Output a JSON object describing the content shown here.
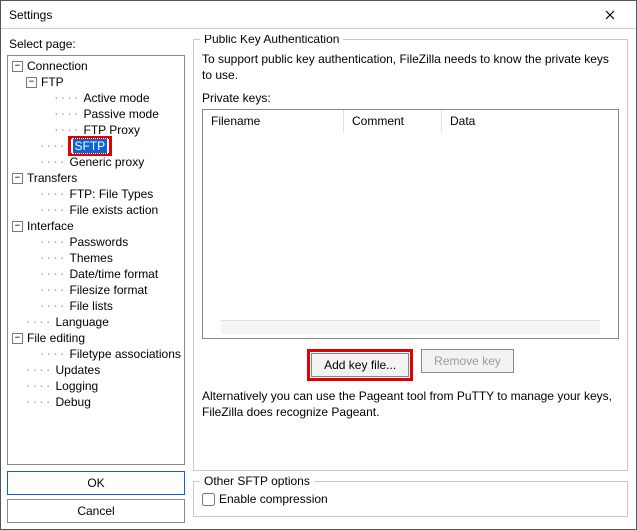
{
  "window": {
    "title": "Settings"
  },
  "left": {
    "label": "Select page:",
    "ok": "OK",
    "cancel": "Cancel"
  },
  "tree": {
    "connection": {
      "label": "Connection",
      "ftp": {
        "label": "FTP",
        "active": "Active mode",
        "passive": "Passive mode",
        "proxy": "FTP Proxy"
      },
      "sftp": "SFTP",
      "generic_proxy": "Generic proxy"
    },
    "transfers": {
      "label": "Transfers",
      "filetypes": "FTP: File Types",
      "fileexists": "File exists action"
    },
    "interface": {
      "label": "Interface",
      "passwords": "Passwords",
      "themes": "Themes",
      "datetime": "Date/time format",
      "filesize": "Filesize format",
      "filelists": "File lists"
    },
    "language": "Language",
    "fileediting": {
      "label": "File editing",
      "assoc": "Filetype associations"
    },
    "updates": "Updates",
    "logging": "Logging",
    "debug": "Debug"
  },
  "pk": {
    "group_title": "Public Key Authentication",
    "desc": "To support public key authentication, FileZilla needs to know the private keys to use.",
    "list_label": "Private keys:",
    "cols": {
      "filename": "Filename",
      "comment": "Comment",
      "data": "Data"
    },
    "add": "Add key file...",
    "remove": "Remove key",
    "alt": "Alternatively you can use the Pageant tool from PuTTY to manage your keys, FileZilla does recognize Pageant."
  },
  "other": {
    "group_title": "Other SFTP options",
    "compress": "Enable compression"
  }
}
